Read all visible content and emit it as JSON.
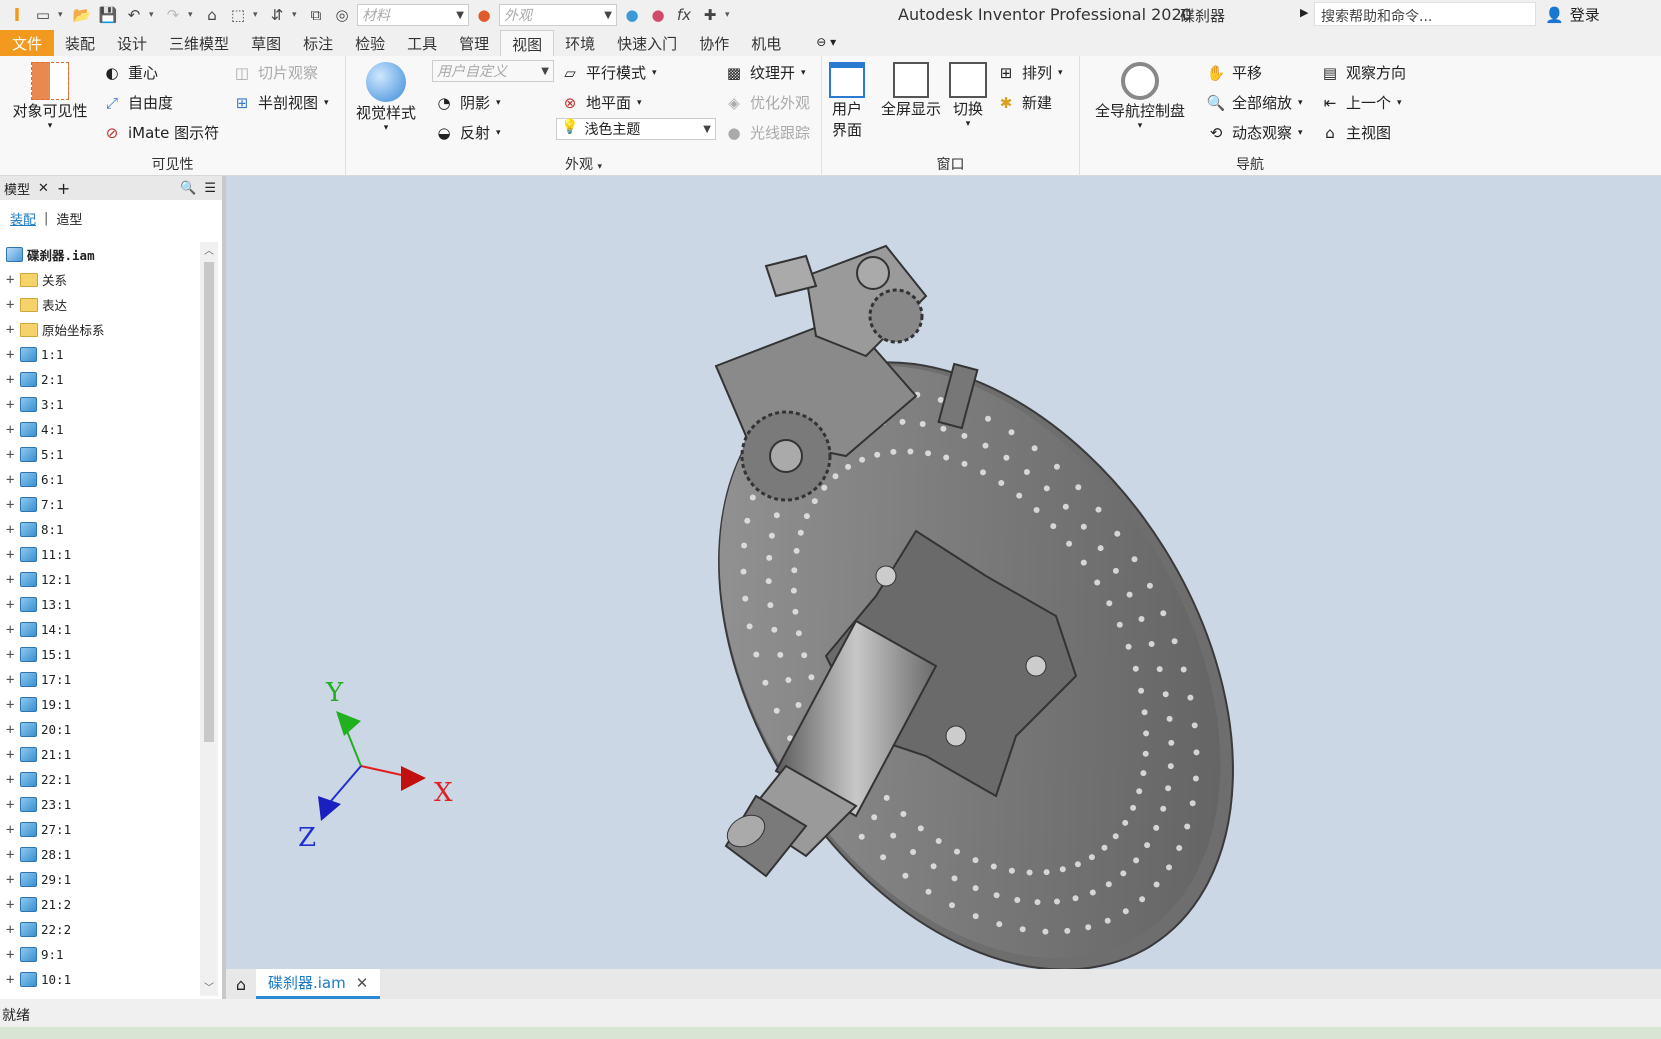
{
  "app": {
    "title": "Autodesk Inventor Professional 2020",
    "filename": "碟刹器"
  },
  "quick_access": {
    "material_placeholder": "材料",
    "appearance_placeholder": "外观"
  },
  "search": {
    "placeholder": "搜索帮助和命令..."
  },
  "login": {
    "label": "登录"
  },
  "tabs": [
    {
      "label": "文件"
    },
    {
      "label": "装配"
    },
    {
      "label": "设计"
    },
    {
      "label": "三维模型"
    },
    {
      "label": "草图"
    },
    {
      "label": "标注"
    },
    {
      "label": "检验"
    },
    {
      "label": "工具"
    },
    {
      "label": "管理"
    },
    {
      "label": "视图"
    },
    {
      "label": "环境"
    },
    {
      "label": "快速入门"
    },
    {
      "label": "协作"
    },
    {
      "label": "机电"
    }
  ],
  "ribbon": {
    "visibility": {
      "label": "可见性",
      "object_visibility": "对象可见性",
      "center_of_gravity": "重心",
      "dof": "自由度",
      "imate": "iMate 图示符",
      "slice": "切片观察",
      "half_section": "半剖视图"
    },
    "appearance": {
      "label": "外观",
      "visual_style": "视觉样式",
      "user_defined": "用户自定义",
      "shadow": "阴影",
      "reflection": "反射",
      "parallel": "平行模式",
      "ground": "地平面",
      "light_theme": "浅色主题",
      "texture": "纹理开",
      "optimize": "优化外观",
      "ray_trace": "光线跟踪"
    },
    "window": {
      "label": "窗口",
      "user_interface": [
        "用户",
        "界面"
      ],
      "fullscreen": "全屏显示",
      "switch": "切换",
      "arrange": "排列",
      "new": "新建"
    },
    "navigate": {
      "label": "导航",
      "steering_wheel": "全导航控制盘",
      "pan": "平移",
      "zoom_all": "全部缩放",
      "orbit": "动态观察",
      "look_at": "观察方向",
      "previous": "上一个",
      "home": "主视图"
    }
  },
  "browser": {
    "title": "模型",
    "subtabs": [
      "装配",
      "造型"
    ],
    "root": "碟刹器.iam",
    "folders": [
      "关系",
      "表达",
      "原始坐标系"
    ],
    "parts": [
      "1:1",
      "2:1",
      "3:1",
      "4:1",
      "5:1",
      "6:1",
      "7:1",
      "8:1",
      "11:1",
      "12:1",
      "13:1",
      "14:1",
      "15:1",
      "17:1",
      "19:1",
      "20:1",
      "21:1",
      "22:1",
      "23:1",
      "27:1",
      "28:1",
      "29:1",
      "21:2",
      "22:2",
      "9:1",
      "10:1"
    ]
  },
  "triad": {
    "x": "X",
    "y": "Y",
    "z": "Z"
  },
  "document_tab": {
    "label": "碟刹器.iam"
  },
  "status": {
    "text": "就绪"
  },
  "colors": {
    "file_tab": "#f29a1f",
    "viewport_bg": "#ccd7e6",
    "active_doc": "#1a7ac4",
    "axis_x": "#e02020",
    "axis_y": "#20b020",
    "axis_z": "#2030d0"
  }
}
